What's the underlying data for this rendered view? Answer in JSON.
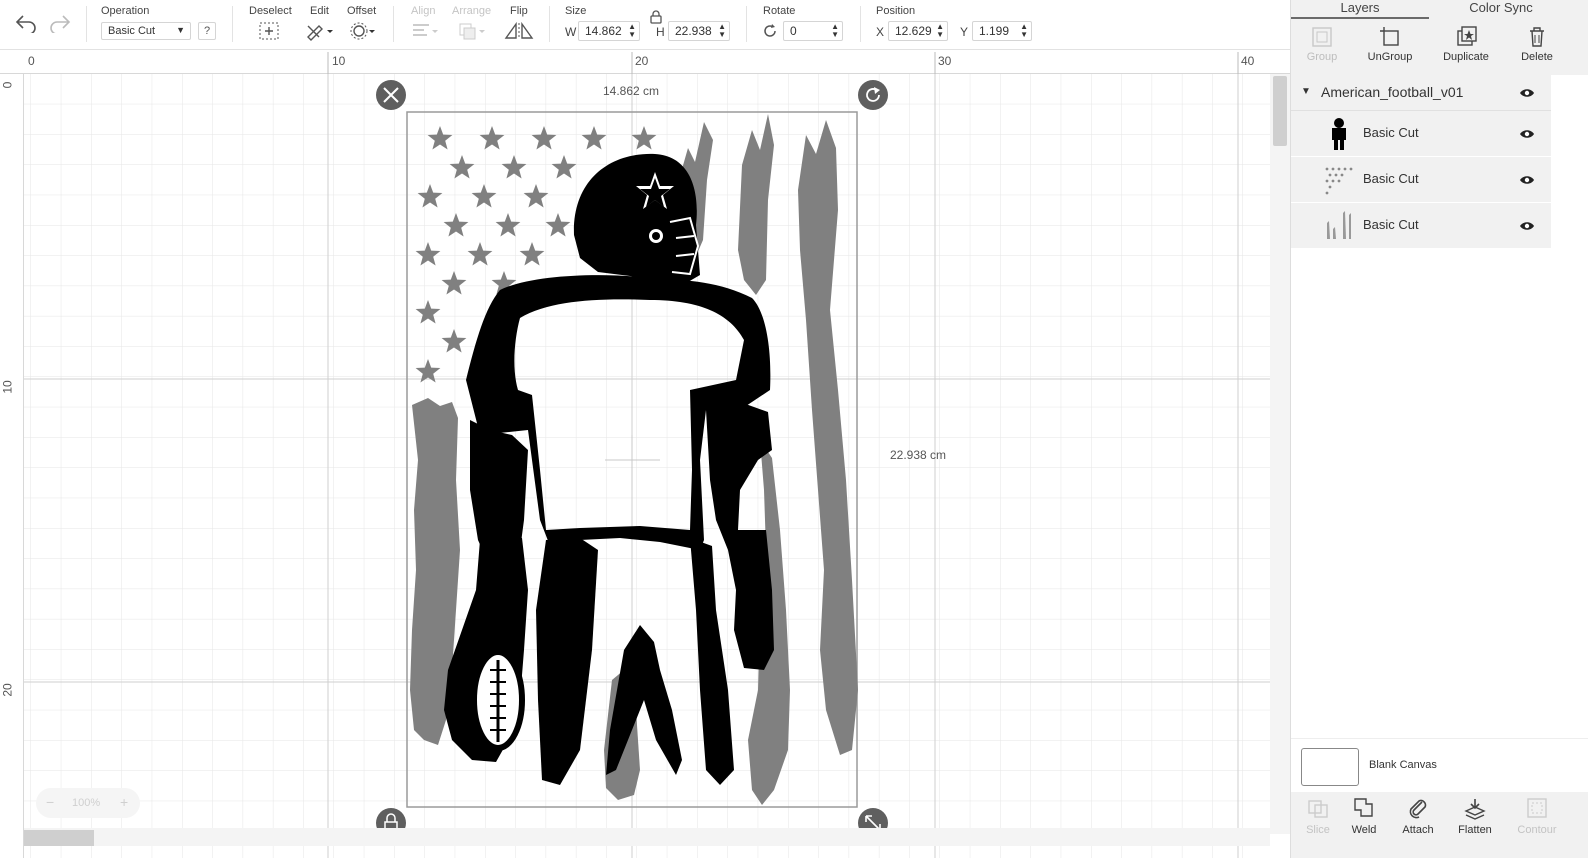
{
  "toolbar": {
    "operation_label": "Operation",
    "operation_value": "Basic Cut",
    "help_label": "?",
    "deselect_label": "Deselect",
    "edit_label": "Edit",
    "offset_label": "Offset",
    "align_label": "Align",
    "arrange_label": "Arrange",
    "flip_label": "Flip",
    "size_label": "Size",
    "w_letter": "W",
    "w_value": "14.862",
    "h_letter": "H",
    "h_value": "22.938",
    "rotate_label": "Rotate",
    "rotate_value": "0",
    "position_label": "Position",
    "x_letter": "X",
    "x_value": "12.629",
    "y_letter": "Y",
    "y_value": "1.199"
  },
  "ruler": {
    "top": [
      "0",
      "10",
      "20",
      "30",
      "40"
    ],
    "left": [
      "0",
      "10",
      "20"
    ]
  },
  "selection": {
    "width_label": "14.862 cm",
    "height_label": "22.938 cm"
  },
  "zoom": {
    "minus": "−",
    "value": "100%",
    "plus": "+"
  },
  "panel": {
    "tabs": [
      "Layers",
      "Color Sync"
    ],
    "actions": [
      "Group",
      "UnGroup",
      "Duplicate",
      "Delete"
    ],
    "group_name": "American_football_v01",
    "layers": [
      {
        "name": "Basic Cut",
        "thumb": "player-thumb"
      },
      {
        "name": "Basic Cut",
        "thumb": "stars-thumb"
      },
      {
        "name": "Basic Cut",
        "thumb": "stripes-thumb"
      }
    ],
    "blank_canvas": "Blank Canvas",
    "bottom_actions": [
      "Slice",
      "Weld",
      "Attach",
      "Flatten",
      "Contour"
    ]
  },
  "colors": {
    "accent": "#5f5f5f",
    "artwork_black": "#000000",
    "artwork_grey": "#808080",
    "grid": "#e6e6e6"
  },
  "icons": [
    "undo-icon",
    "redo-icon",
    "deselect-icon",
    "edit-icon",
    "offset-icon",
    "align-icon",
    "arrange-icon",
    "flip-icon",
    "lock-icon",
    "rotate-icon",
    "close-icon",
    "rotate-handle-icon",
    "lock-handle-icon",
    "resize-handle-icon",
    "eye-icon",
    "chevron-down-icon"
  ]
}
